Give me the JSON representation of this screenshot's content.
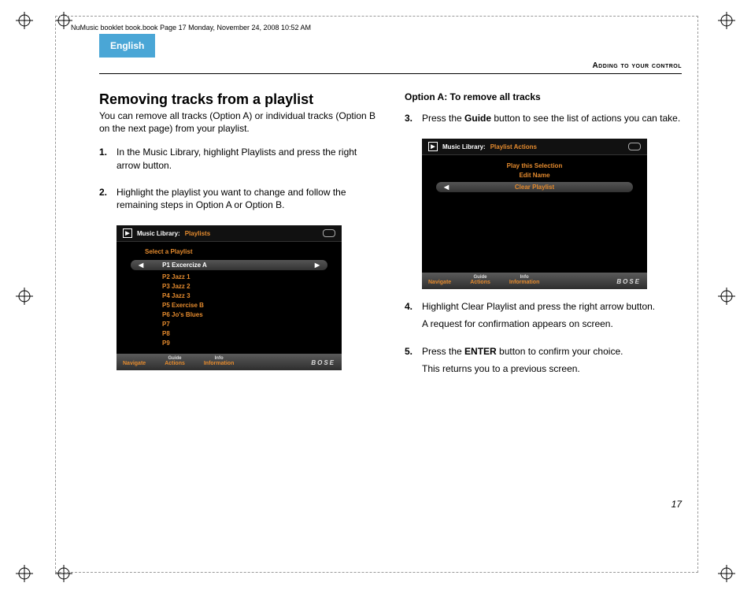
{
  "meta": {
    "header_line": "NuMusic booklet book.book  Page 17  Monday, November 24, 2008  10:52 AM",
    "language_tab": "English",
    "running_head": "Adding to your control",
    "page_number": "17"
  },
  "left": {
    "title": "Removing tracks from a playlist",
    "lead": "You can remove all tracks (Option A) or individual tracks (Option B on the next page) from your playlist.",
    "step1": {
      "num": "1.",
      "text": "In the Music Library, highlight Playlists and press the right arrow button."
    },
    "step2": {
      "num": "2.",
      "text": "Highlight the playlist you want to change and follow the remaining steps in Option A or Option B."
    }
  },
  "right": {
    "subhead": "Option A: To remove all tracks",
    "step3": {
      "num": "3.",
      "pre": "Press the ",
      "bold": "Guide",
      "post": " button to see the list of actions you can take."
    },
    "step4": {
      "num": "4.",
      "line1": "Highlight Clear Playlist and press the right arrow button.",
      "line2": "A request for confirmation appears on screen."
    },
    "step5": {
      "num": "5.",
      "pre": "Press the ",
      "bold": "ENTER",
      "post": " button to confirm your choice.",
      "line2": "This returns you to a previous screen."
    }
  },
  "screen1": {
    "title1": "Music Library:",
    "title2": "Playlists",
    "hint": "Select a Playlist",
    "selected": "P1 Excercize A",
    "items": [
      "P2 Jazz 1",
      "P3 Jazz 2",
      "P4 Jazz 3",
      "P5 Exercise B",
      "P6 Jo's Blues",
      "P7",
      "P8",
      "P9"
    ],
    "footer": {
      "navigate": "Navigate",
      "guide_top": "Guide",
      "guide_bot": "Actions",
      "info_top": "Info",
      "info_bot": "Information",
      "brand": "BOSE"
    }
  },
  "screen2": {
    "title1": "Music Library:",
    "title2": "Playlist Actions",
    "items": [
      "Play this Selection",
      "Edit Name"
    ],
    "selected": "Clear Playlist",
    "footer": {
      "navigate": "Navigate",
      "guide_top": "Guide",
      "guide_bot": "Actions",
      "info_top": "Info",
      "info_bot": "Information",
      "brand": "BOSE"
    }
  }
}
